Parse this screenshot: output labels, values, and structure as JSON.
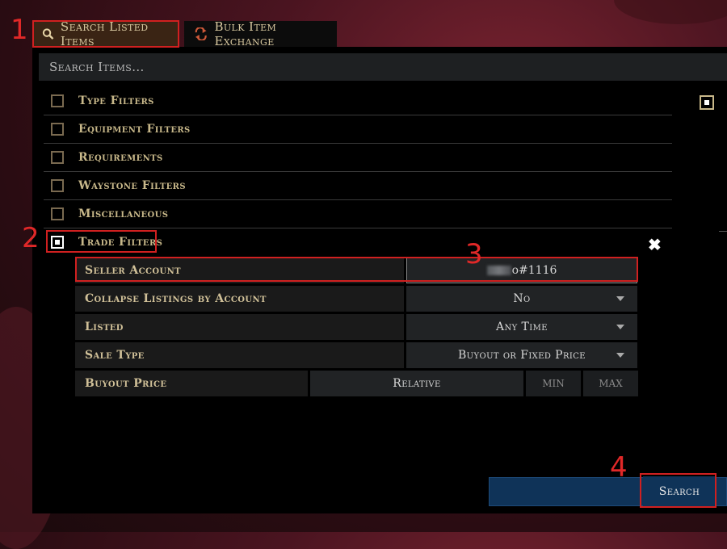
{
  "tabs": {
    "search_listed": "Search Listed Items",
    "bulk_exchange": "Bulk Item Exchange"
  },
  "search": {
    "placeholder": "Search Items..."
  },
  "filter_groups": [
    {
      "label": "Type Filters",
      "checked": false
    },
    {
      "label": "Equipment Filters",
      "checked": false
    },
    {
      "label": "Requirements",
      "checked": false
    },
    {
      "label": "Waystone Filters",
      "checked": false
    },
    {
      "label": "Miscellaneous",
      "checked": false
    },
    {
      "label": "Trade Filters",
      "checked": true
    }
  ],
  "trade_filters": {
    "seller_account": {
      "label": "Seller Account",
      "value_suffix": "o#1116"
    },
    "collapse": {
      "label": "Collapse Listings by Account",
      "value": "No"
    },
    "listed": {
      "label": "Listed",
      "value": "Any Time"
    },
    "sale_type": {
      "label": "Sale Type",
      "value": "Buyout or Fixed Price"
    },
    "buyout_price": {
      "label": "Buyout Price",
      "mode": "Relative",
      "min_placeholder": "MIN",
      "max_placeholder": "MAX"
    }
  },
  "close_symbol": "✖",
  "search_button": "Search",
  "annotations": [
    "1",
    "2",
    "3",
    "4"
  ],
  "colors": {
    "annotation": "#d02020",
    "panel": "#000000",
    "accent_gold": "#c8b88a",
    "search_blue": "#0f3358"
  }
}
